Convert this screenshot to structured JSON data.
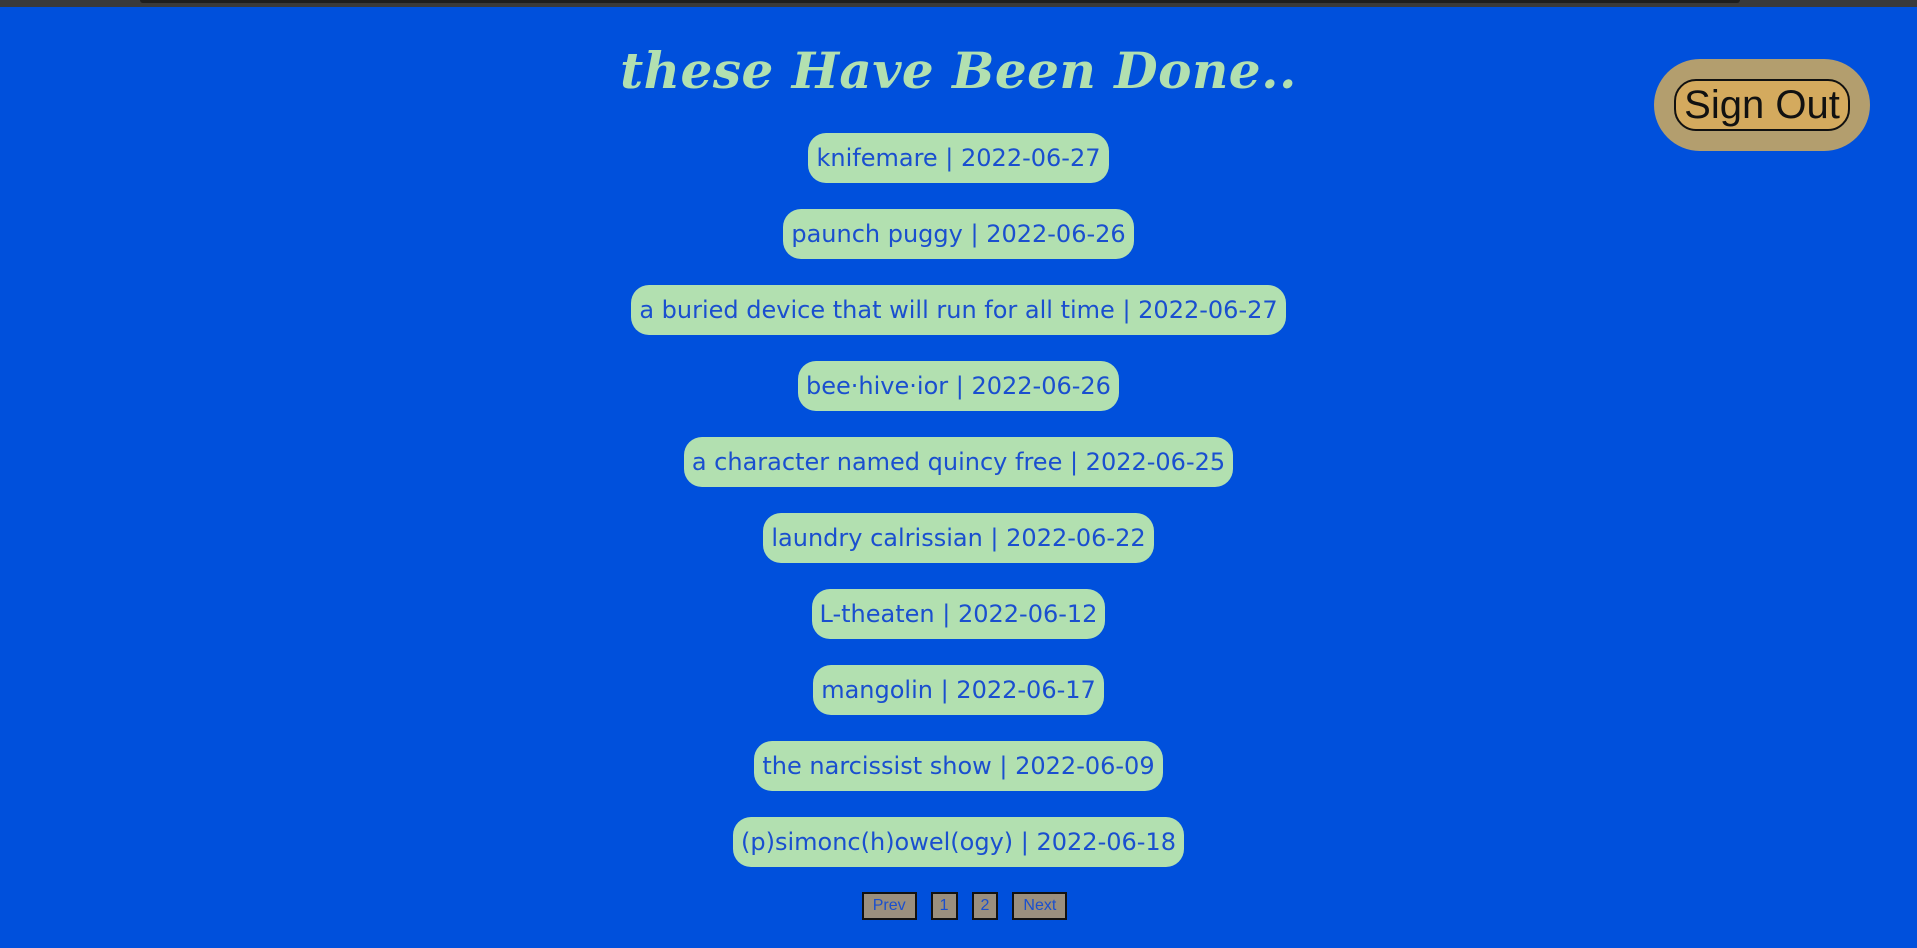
{
  "header": {
    "title": "these Have Been Done..",
    "sign_out_label": "Sign Out"
  },
  "items": [
    {
      "label": "knifemare | 2022-06-27"
    },
    {
      "label": "paunch puggy | 2022-06-26"
    },
    {
      "label": "a buried device that will run for all time | 2022-06-27"
    },
    {
      "label": "bee·hive·ior | 2022-06-26"
    },
    {
      "label": "a character named quincy free | 2022-06-25"
    },
    {
      "label": "laundry calrissian | 2022-06-22"
    },
    {
      "label": "L-theaten | 2022-06-12"
    },
    {
      "label": "mangolin | 2022-06-17"
    },
    {
      "label": "the narcissist show | 2022-06-09"
    },
    {
      "label": "(p)simonc(h)owel(ogy) | 2022-06-18"
    }
  ],
  "pagination": {
    "prev_label": "Prev",
    "pages": [
      "1",
      "2"
    ],
    "next_label": "Next"
  },
  "colors": {
    "background": "#0050dc",
    "item_bg": "#b2e0b0",
    "item_text": "#1a4fcf",
    "signout_outer": "#b39e6e",
    "signout_inner": "#d4aa5e"
  }
}
